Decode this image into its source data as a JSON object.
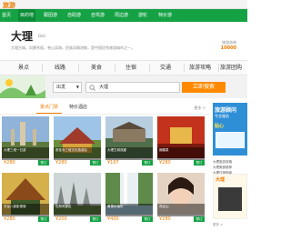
{
  "logo": "旅游",
  "nav": [
    {
      "label": "首页",
      "active": false
    },
    {
      "label": "目的地",
      "active": true
    },
    {
      "label": "跟团游",
      "active": false
    },
    {
      "label": "自助游",
      "active": false
    },
    {
      "label": "自驾游",
      "active": false
    },
    {
      "label": "周边游",
      "active": false
    },
    {
      "label": "游轮",
      "active": false
    },
    {
      "label": "特价游",
      "active": false
    }
  ],
  "destination": {
    "name": "大理",
    "pinyin": "Dali",
    "desc": "大理古城，风景秀丽，苍山洱海，民族风情浓郁，是中国优秀旅游城市之一。",
    "phone_label": "旅游咨询",
    "phone": "10000"
  },
  "tabs": [
    "景点",
    "线路",
    "美食",
    "住宿",
    "交通",
    "旅游攻略",
    "旅游团购"
  ],
  "search": {
    "select": "出发",
    "value": "大理",
    "button": "立即搜索"
  },
  "section": {
    "tab1": "景点门票",
    "tab2": "特价酒店",
    "more": "更多 >"
  },
  "cards": [
    {
      "caption": "大理三塔一日游",
      "price": "¥280",
      "buy": "预订"
    },
    {
      "caption": "崇圣寺三塔文化旅游区",
      "price": "¥280",
      "buy": "预订"
    },
    {
      "caption": "大理古城双廊",
      "price": "¥167",
      "buy": "预订"
    },
    {
      "caption": "蝴蝶泉",
      "price": "¥280",
      "buy": "预订"
    },
    {
      "caption": "天龙八部影视城",
      "price": "¥280",
      "buy": "预订"
    },
    {
      "caption": "石林风景区",
      "price": "¥200",
      "buy": "预订"
    },
    {
      "caption": "黄果树瀑布",
      "price": "¥400",
      "buy": "预订"
    },
    {
      "caption": "鸡足山",
      "price": "¥280",
      "buy": "预订"
    }
  ],
  "side": {
    "ad_title": "旅游顾问",
    "ad_sub": "专业服务",
    "ad_hl": "贴心",
    "list": [
      "大理旅游攻略",
      "大理美食推荐",
      "大理住宿指南"
    ],
    "book_title": "大理",
    "foot": "更多 >"
  }
}
